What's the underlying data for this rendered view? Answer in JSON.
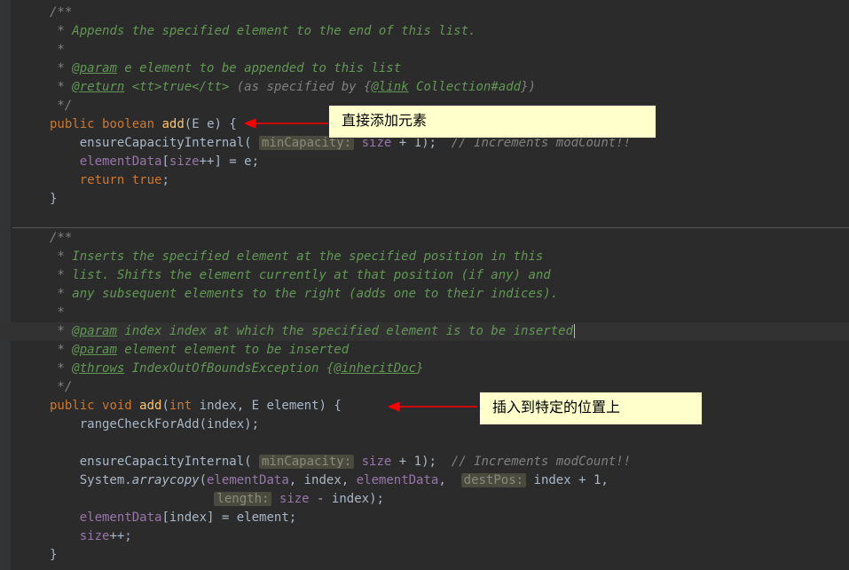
{
  "callouts": {
    "c1": "直接添加元素",
    "c2": "插入到特定的位置上"
  },
  "code": {
    "l01": "/**",
    "l02_a": " * ",
    "l02_b": "Appends the specified element to the end of this list.",
    "l03": " *",
    "l04_a": " * ",
    "l04_tag": "@param",
    "l04_b": " e element to be appended to this list",
    "l05_a": " * ",
    "l05_tag": "@return",
    "l05_b": " <tt>true</tt> ",
    "l05_c": "(as specified by {",
    "l05_tag2": "@link",
    "l05_d": " Collection#add",
    "l05_e": "})",
    "l06": " */",
    "l07_kw1": "public",
    "l07_kw2": "boolean",
    "l07_mth": "add",
    "l07_typ": "E",
    "l07_p": "e",
    "l08_m": "ensureCapacityInternal",
    "l08_hint": "minCapacity:",
    "l08_fld": "size",
    "l08_n": "1",
    "l08_cm": "// Increments modCount!!",
    "l09_fld": "elementData",
    "l09_fld2": "size",
    "l09_e": "e",
    "l10_kw": "return",
    "l10_v": "true",
    "l11": "}",
    "l12": "/**",
    "l13_a": " * ",
    "l13_b": "Inserts the specified element at the specified position in this",
    "l14_a": " * ",
    "l14_b": "list. Shifts the element currently at that position (if any) and",
    "l15_a": " * ",
    "l15_b": "any subsequent elements to the right (adds one to their indices).",
    "l16": " *",
    "l17_a": " * ",
    "l17_tag": "@param",
    "l17_b": " index index at which the specified element is to be inserted",
    "l18_a": " * ",
    "l18_tag": "@param",
    "l18_b": " element element to be inserted",
    "l19_a": " * ",
    "l19_tag": "@throws",
    "l19_b": " IndexOutOfBoundsException {",
    "l19_tag2": "@inheritDoc",
    "l19_c": "}",
    "l20": " */",
    "l21_kw1": "public",
    "l21_kw2": "void",
    "l21_mth": "add",
    "l21_t1": "int",
    "l21_p1": "index",
    "l21_t2": "E",
    "l21_p2": "element",
    "l22_m": "rangeCheckForAdd",
    "l22_p": "index",
    "l23_m": "ensureCapacityInternal",
    "l23_hint": "minCapacity:",
    "l23_fld": "size",
    "l23_n": "1",
    "l23_cm": "// Increments modCount!!",
    "l24_cls": "System",
    "l24_m": "arraycopy",
    "l24_fld": "elementData",
    "l24_p1": "index",
    "l24_hint": "destPos:",
    "l24_n": "1",
    "l25_hint": "length:",
    "l25_fld": "size",
    "l25_p": "index",
    "l26_fld": "elementData",
    "l26_p1": "index",
    "l26_p2": "element",
    "l27_fld": "size",
    "l28": "}"
  }
}
